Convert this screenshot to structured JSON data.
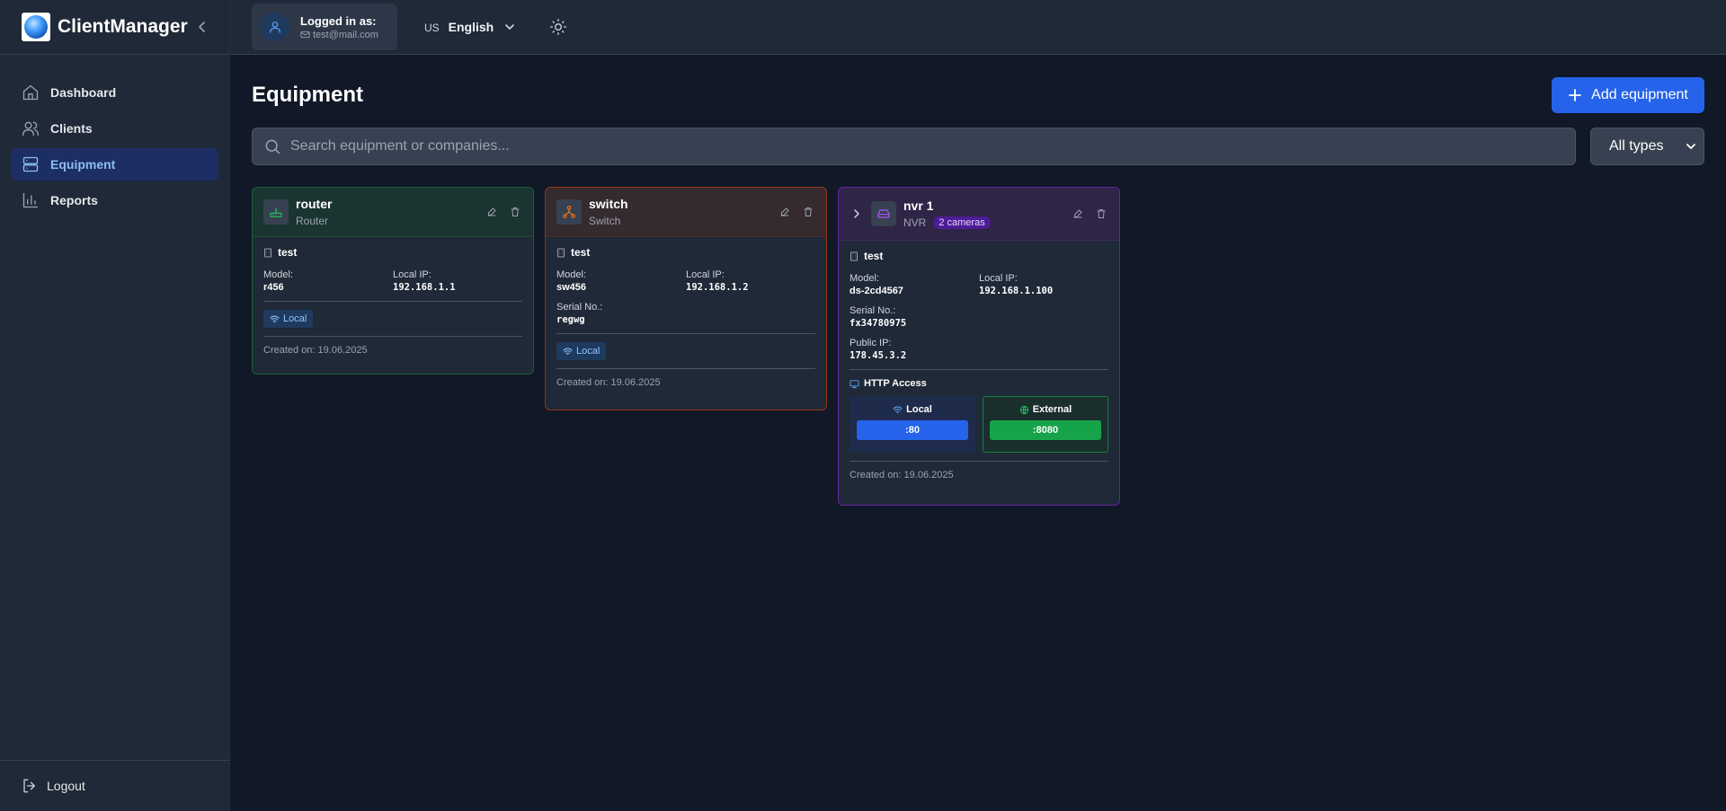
{
  "app": {
    "name": "ClientManager"
  },
  "user": {
    "logged_in_label": "Logged in as:",
    "email": "test@mail.com"
  },
  "language": {
    "flag": "US",
    "name": "English"
  },
  "sidebar": {
    "items": [
      {
        "label": "Dashboard",
        "icon": "home-icon"
      },
      {
        "label": "Clients",
        "icon": "users-icon"
      },
      {
        "label": "Equipment",
        "icon": "server-icon",
        "active": true
      },
      {
        "label": "Reports",
        "icon": "bar-chart-icon"
      }
    ],
    "logout": "Logout"
  },
  "page": {
    "title": "Equipment",
    "add_button": "Add equipment",
    "search_placeholder": "Search equipment or companies...",
    "type_filter": "All types"
  },
  "cards": [
    {
      "name": "router",
      "type": "Router",
      "company": "test",
      "model_label": "Model:",
      "model": "r456",
      "local_ip_label": "Local IP:",
      "local_ip": "192.168.1.1",
      "access": "Local",
      "created": "Created on: 19.06.2025",
      "accent": "#15803d",
      "head_bg": "#1a3a32",
      "icon_color": "#22c55e"
    },
    {
      "name": "switch",
      "type": "Switch",
      "company": "test",
      "model_label": "Model:",
      "model": "sw456",
      "local_ip_label": "Local IP:",
      "local_ip": "192.168.1.2",
      "serial_label": "Serial No.:",
      "serial": "regwg",
      "access": "Local",
      "created": "Created on: 19.06.2025",
      "accent": "#c2410c",
      "head_bg": "#3b2a2a",
      "icon_color": "#f97316"
    },
    {
      "name": "nvr 1",
      "type": "NVR",
      "cameras": "2 cameras",
      "company": "test",
      "model_label": "Model:",
      "model": "ds-2cd4567",
      "local_ip_label": "Local IP:",
      "local_ip": "192.168.1.100",
      "serial_label": "Serial No.:",
      "serial": "fx34780975",
      "public_ip_label": "Public IP:",
      "public_ip": "178.45.3.2",
      "http_title": "HTTP Access",
      "http_local_label": "Local",
      "http_local_port": ":80",
      "http_external_label": "External",
      "http_external_port": ":8080",
      "created": "Created on: 19.06.2025",
      "accent": "#7e22ce",
      "head_bg": "#32264d",
      "icon_color": "#a855f7"
    }
  ],
  "colors": {
    "background": "#111827",
    "sidebar": "#1f2937",
    "primary": "#2563eb",
    "success": "#16a34a"
  }
}
